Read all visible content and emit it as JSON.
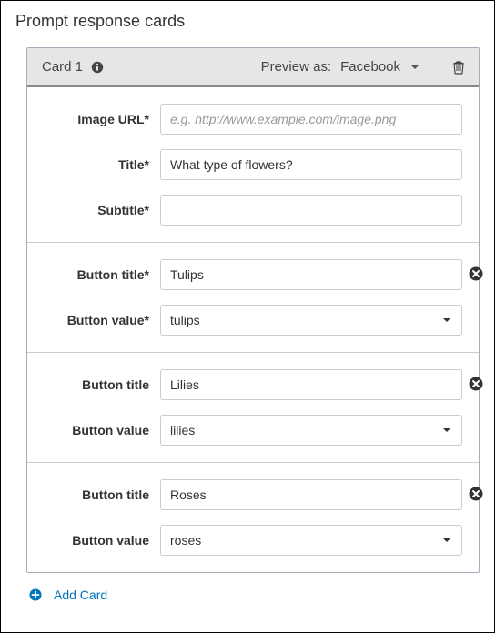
{
  "page_title": "Prompt response cards",
  "card": {
    "label": "Card 1",
    "preview_label": "Preview as:",
    "preview_value": "Facebook",
    "fields": {
      "image_url_label": "Image URL*",
      "image_url_value": "",
      "image_url_placeholder": "e.g. http://www.example.com/image.png",
      "title_label": "Title*",
      "title_value": "What type of flowers?",
      "subtitle_label": "Subtitle*",
      "subtitle_value": ""
    },
    "buttons": [
      {
        "title_label": "Button title*",
        "title_value": "Tulips",
        "value_label": "Button value*",
        "value_value": "tulips"
      },
      {
        "title_label": "Button title",
        "title_value": "Lilies",
        "value_label": "Button value",
        "value_value": "lilies"
      },
      {
        "title_label": "Button title",
        "title_value": "Roses",
        "value_label": "Button value",
        "value_value": "roses"
      }
    ]
  },
  "add_card_label": "Add Card"
}
